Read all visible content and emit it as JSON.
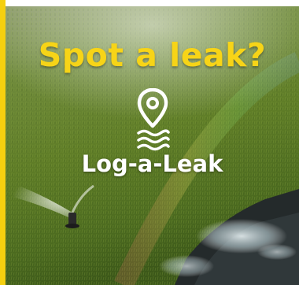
{
  "headline": "Spot a leak?",
  "logo_text": "Log-a-Leak",
  "logo_icon": "map-pin-water-icon",
  "colors": {
    "accent": "#f5d00f",
    "headline": "#f7d417",
    "logo": "#ffffff"
  }
}
